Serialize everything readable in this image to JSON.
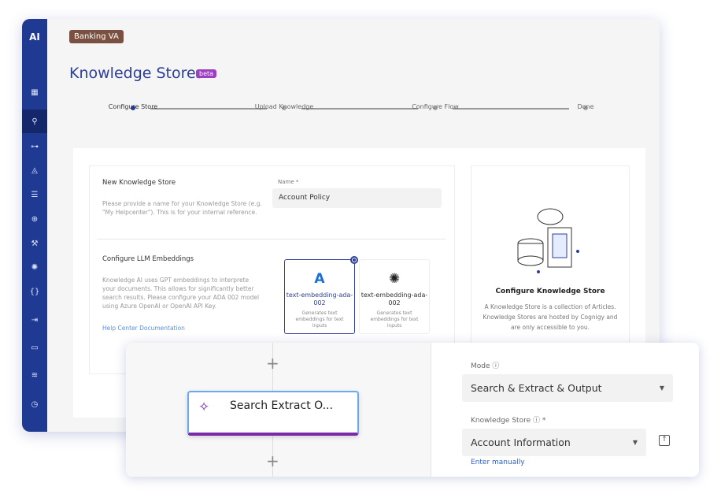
{
  "sidebar": {
    "logo": "AI",
    "items": [
      "grid-icon",
      "search-icon",
      "sitemap-icon",
      "graduation-cap-icon",
      "list-icon",
      "globe-icon",
      "wrench-icon",
      "lightbulb-icon",
      "braces-icon",
      "logout-icon",
      "chat-icon",
      "layers-icon",
      "clock-icon"
    ],
    "active": 1
  },
  "header": {
    "badge": "Banking VA",
    "title": "Knowledge Stores",
    "beta": "beta"
  },
  "steps": [
    "Configure Store",
    "Upload Knowledge",
    "Configure Flow",
    "Done"
  ],
  "form": {
    "section1_title": "New Knowledge Store",
    "section1_desc": "Please provide a name for your Knowledge Store (e.g. \"My Helpcenter\"). This is for your internal reference.",
    "name_label": "Name *",
    "name_value": "Account Policy",
    "section2_title": "Configure LLM Embeddings",
    "section2_desc": "Knowledge AI uses GPT embeddings to interprete your documents. This allows for significantly better search results. Please configure your ADA 002 model using Azure OpenAI or OpenAI API Key.",
    "help_link": "Help Center Documentation",
    "options": [
      {
        "name": "text-embedding-ada-002",
        "desc": "Generates text embeddings for text inputs",
        "provider": "Azure",
        "selected": true
      },
      {
        "name": "text-embedding-ada-002",
        "desc": "Generates text embeddings for text inputs",
        "provider": "OpenAI",
        "selected": false
      }
    ]
  },
  "info": {
    "title": "Configure Knowledge Store",
    "desc": "A Knowledge Store is a collection of Articles. Knowledge Stores are hosted by Cognigy and are only accessible to you."
  },
  "flow": {
    "node_label": "Search Extract O...",
    "mode_label": "Mode",
    "mode_value": "Search & Extract & Output",
    "store_label": "Knowledge Store",
    "store_required": "*",
    "store_value": "Account Information",
    "enter_manually": "Enter manually"
  },
  "colors": {
    "sidebar": "#1f3a93",
    "accent": "#2c3f94",
    "beta": "#9c3fc0",
    "badge": "#7a5140",
    "node_bar": "#7a2aa8"
  }
}
